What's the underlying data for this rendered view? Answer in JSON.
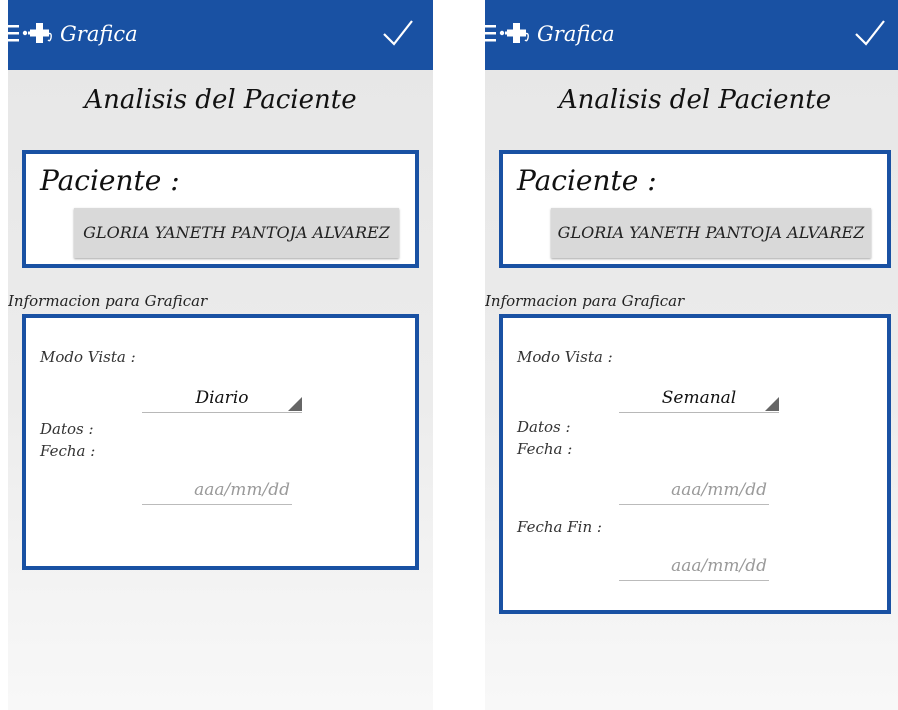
{
  "screens": [
    {
      "appbar": {
        "title": "Grafica"
      },
      "page_title": "Analisis del Paciente",
      "patient": {
        "label": "Paciente :",
        "name": "GLORIA YANETH PANTOJA ALVAREZ"
      },
      "section_label": "Informacion para Graficar",
      "form": {
        "modo_vista_label": "Modo Vista :",
        "modo_vista_value": "Diario",
        "datos_label": "Datos :",
        "fecha_label": "Fecha :",
        "fecha_placeholder": "aaa/mm/dd"
      }
    },
    {
      "appbar": {
        "title": "Grafica"
      },
      "page_title": "Analisis del Paciente",
      "patient": {
        "label": "Paciente :",
        "name": "GLORIA YANETH PANTOJA ALVAREZ"
      },
      "section_label": "Informacion para Graficar",
      "form": {
        "modo_vista_label": "Modo Vista :",
        "modo_vista_value": "Semanal",
        "datos_label": "Datos :",
        "fecha_label": "Fecha :",
        "fecha_placeholder": "aaa/mm/dd",
        "fecha_fin_label": "Fecha Fin :",
        "fecha_fin_placeholder": "aaa/mm/dd"
      }
    }
  ]
}
